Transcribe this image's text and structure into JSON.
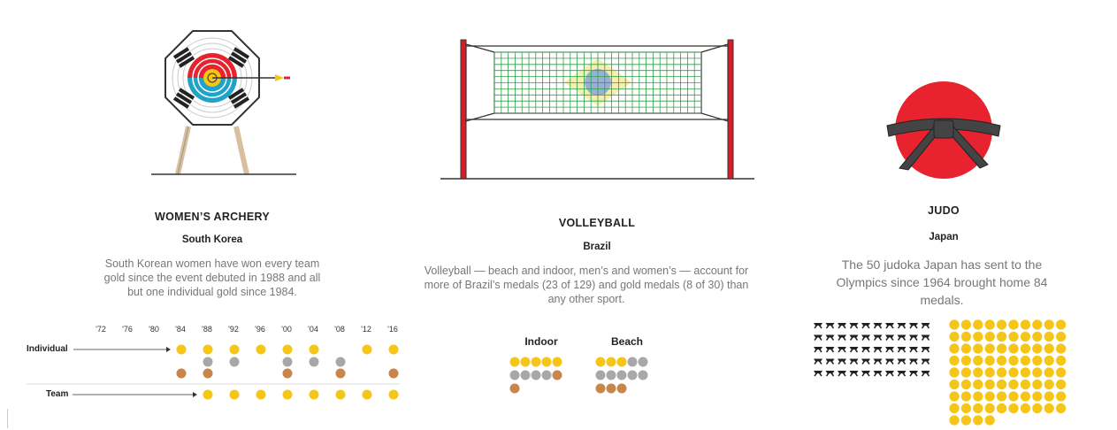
{
  "archery": {
    "title": "WOMEN’S ARCHERY",
    "country": "South Korea",
    "description": "South Korean women have won every team gold since the event debuted in 1988 and all but one individual gold since 1984."
  },
  "volleyball": {
    "title": "VOLLEYBALL",
    "country": "Brazil",
    "description": "Volleyball — beach and indoor, men’s and women’s — account for more of Brazil’s medals (23 of 129) and gold medals (8 of 30) than any other sport."
  },
  "judo": {
    "title": "JUDO",
    "country": "Japan",
    "description": "The 50 judoka Japan has sent to the Olympics since 1964 brought home 84 medals."
  },
  "colors": {
    "gold": "#f5c518",
    "silver": "#a8a8a8",
    "bronze": "#c8864a",
    "red": "#e8222e",
    "net_green": "#2e9e44"
  },
  "chart_data": [
    {
      "type": "scatter",
      "title": "",
      "x_labels": [
        "'72",
        "'76",
        "'80",
        "'84",
        "'88",
        "'92",
        "'96",
        "'00",
        "'04",
        "'08",
        "'12",
        "'16"
      ],
      "row_labels": [
        "Individual",
        "Team"
      ],
      "individual": [
        [],
        [],
        [],
        [
          "gold",
          "bronze"
        ],
        [
          "gold",
          "silver",
          "bronze"
        ],
        [
          "gold",
          "silver"
        ],
        [
          "gold"
        ],
        [
          "gold",
          "silver",
          "bronze"
        ],
        [
          "gold",
          "silver"
        ],
        [
          "silver",
          "bronze"
        ],
        [
          "gold"
        ],
        [
          "gold",
          "bronze"
        ]
      ],
      "team": [
        [],
        [],
        [],
        [],
        [
          "gold"
        ],
        [
          "gold"
        ],
        [
          "gold"
        ],
        [
          "gold"
        ],
        [
          "gold"
        ],
        [
          "gold"
        ],
        [
          "gold"
        ],
        [
          "gold"
        ]
      ]
    },
    {
      "type": "scatter",
      "title": "",
      "series": [
        {
          "name": "Indoor",
          "dots": [
            "gold",
            "gold",
            "gold",
            "gold",
            "gold",
            "silver",
            "silver",
            "silver",
            "silver",
            "bronze",
            "bronze"
          ]
        },
        {
          "name": "Beach",
          "dots": [
            "gold",
            "gold",
            "gold",
            "silver",
            "silver",
            "silver",
            "silver",
            "silver",
            "silver",
            "silver",
            "bronze",
            "bronze",
            "bronze"
          ]
        }
      ]
    },
    {
      "type": "scatter",
      "title": "",
      "judoka_count": 50,
      "medal_count": 84
    }
  ]
}
